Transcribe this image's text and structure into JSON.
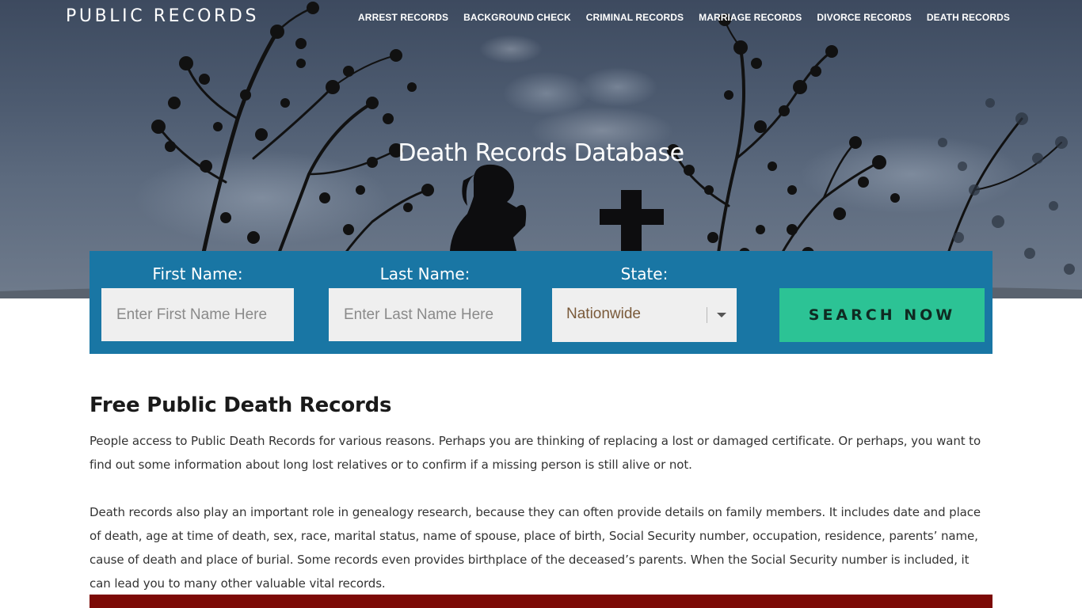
{
  "header": {
    "brand": "PUBLIC RECORDS",
    "nav": [
      {
        "label": "ARREST RECORDS"
      },
      {
        "label": "BACKGROUND CHECK"
      },
      {
        "label": "CRIMINAL RECORDS"
      },
      {
        "label": "MARRIAGE RECORDS"
      },
      {
        "label": "DIVORCE RECORDS"
      },
      {
        "label": "DEATH RECORDS"
      }
    ]
  },
  "hero": {
    "title": "Death Records Database"
  },
  "search": {
    "first_name_label": "First Name:",
    "first_name_placeholder": "Enter First Name Here",
    "first_name_value": "",
    "last_name_label": "Last Name:",
    "last_name_placeholder": "Enter Last Name Here",
    "last_name_value": "",
    "state_label": "State:",
    "state_value": "Nationwide",
    "button_label": "SEARCH NOW"
  },
  "article": {
    "heading": "Free Public Death Records",
    "paragraphs": [
      "People access to Public Death Records for various reasons. Perhaps you are thinking of replacing a lost or damaged certificate. Or perhaps, you want to find out some information about long lost relatives or to confirm if a missing person is still alive or not.",
      "Death records also play an important role in genealogy research, because they can often provide details on family members. It includes date and place of death, age at time of death, sex, race, marital status, name of spouse, place of birth, Social Security number, occupation, residence, parents’ name, cause of death and place of burial. Some records even provides birthplace of the deceased’s parents. When the Social Security number is included, it can lead you to many other valuable vital records."
    ]
  },
  "colors": {
    "search_panel": "#1976a4",
    "search_button": "#2cc395",
    "bottom_band": "#7c0a06",
    "state_value_text": "#7a5a3a"
  },
  "icons": {
    "select_caret": "chevron-down-icon",
    "hero_image": "mourning-silhouette-image"
  }
}
